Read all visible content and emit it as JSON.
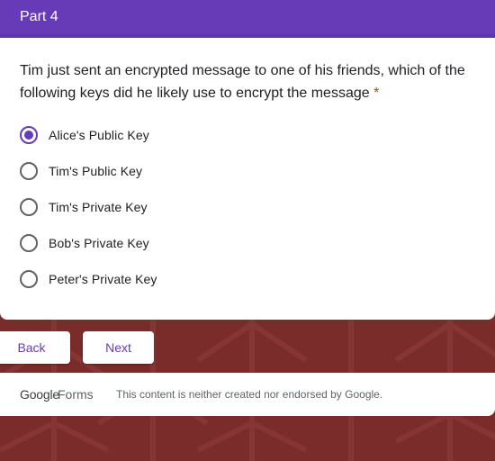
{
  "section": {
    "title": "Part 4"
  },
  "question": {
    "text": "Tim just sent an encrypted message to one of his friends, which of the following keys did he likely use to encrypt the message",
    "required_mark": "*",
    "selected_index": 0,
    "options": [
      "Alice's Public Key",
      "Tim's Public Key",
      "Tim's Private Key",
      "Bob's Private Key",
      "Peter's Private Key"
    ]
  },
  "navigation": {
    "back_label": "Back",
    "next_label": "Next"
  },
  "footer": {
    "logo_google": "Google",
    "logo_forms": "Forms",
    "disclaimer": "This content is neither created nor endorsed by Google."
  },
  "colors": {
    "accent": "#673ab7",
    "background": "#7a2c2b",
    "required": "#d93025"
  }
}
